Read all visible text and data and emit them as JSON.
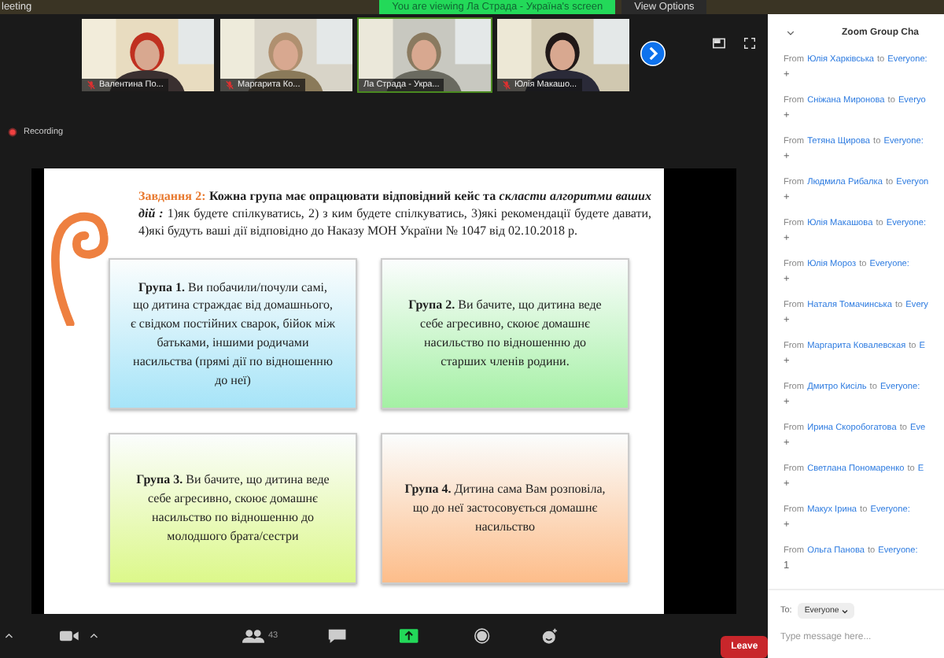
{
  "top_bar": {
    "title": "leeting",
    "banner": "You are viewing Ла Страда - Україна's screen",
    "view_options": "View Options"
  },
  "participants": [
    {
      "name": "Валентина По...",
      "muted": true,
      "speaking": false
    },
    {
      "name": "Маргарита Ко...",
      "muted": true,
      "speaking": false
    },
    {
      "name": "Ла Страда - Укра...",
      "muted": false,
      "speaking": true
    },
    {
      "name": "Юлія Макашо...",
      "muted": true,
      "speaking": false
    }
  ],
  "recording": "Recording",
  "slide": {
    "task_label": "Завдання 2:",
    "task_text": "**Кожна група має опрацювати відповідний кейс та** *скласти алгоритми ваших дій :* 1)як будете спілкуватись, 2) з ким будете спілкуватись, 3)які рекомендації будете давати, 4)які будуть ваші дії відповідно до Наказу МОН України № 1047 від 02.10.2018 р.",
    "groups": [
      {
        "text": "**Група 1.** Ви побачили/почули самі, що дитина страждає від домашнього, є свідком постійних сварок, бійок між батьками, іншими родичами насильства (прямі дії по відношенню до неї)",
        "color": "#a6e4f8"
      },
      {
        "text": "**Група 2.** Ви бачите, що дитина веде себе агресивно, скоює домашнє насильство по відношенню до старших членів родини.",
        "color": "#a4f0a4"
      },
      {
        "text": "**Група 3.** Ви бачите, що дитина веде себе агресивно, скоює домашнє насильство по відношенню до молодшого брата/сестри",
        "color": "#dcf88a"
      },
      {
        "text": "**Група 4.** Дитина сама Вам розповіла, що до неї застосовується домашнє насильство",
        "color": "#fdbd8a"
      }
    ]
  },
  "toolbar": [
    {
      "kind": "caret"
    },
    {
      "kind": "video"
    },
    {
      "kind": "caret"
    },
    {
      "kind": "participants",
      "count": "43"
    },
    {
      "kind": "chat"
    },
    {
      "kind": "share"
    },
    {
      "kind": "record"
    },
    {
      "kind": "reactions"
    }
  ],
  "leave": "Leave",
  "chat": {
    "title": "Zoom Group Cha",
    "messages": [
      {
        "from": "From",
        "sender": "Юлія Харківська",
        "to": "to",
        "recipient": "Everyone:",
        "text": "+"
      },
      {
        "from": "From",
        "sender": "Сніжана Миронова",
        "to": "to",
        "recipient": "Everyo",
        "text": "+"
      },
      {
        "from": "From",
        "sender": "Тетяна Щирова",
        "to": "to",
        "recipient": "Everyone:",
        "text": "+"
      },
      {
        "from": "From",
        "sender": "Людмила Рибалка",
        "to": "to",
        "recipient": "Everyon",
        "text": "+"
      },
      {
        "from": "From",
        "sender": "Юлія Макашова",
        "to": "to",
        "recipient": "Everyone:",
        "text": "+"
      },
      {
        "from": "From",
        "sender": "Юлія Мороз",
        "to": "to",
        "recipient": "Everyone:",
        "text": "+"
      },
      {
        "from": "From",
        "sender": "Наталя Томачинська",
        "to": "to",
        "recipient": "Every",
        "text": "+"
      },
      {
        "from": "From",
        "sender": "Маргарита Ковалевская",
        "to": "to",
        "recipient": "E",
        "text": "+"
      },
      {
        "from": "From",
        "sender": "Дмитро Кисіль",
        "to": "to",
        "recipient": "Everyone:",
        "text": "+"
      },
      {
        "from": "From",
        "sender": "Ирина Скоробогатова",
        "to": "to",
        "recipient": "Eve",
        "text": "+"
      },
      {
        "from": "From",
        "sender": "Светлана Пономаренко",
        "to": "to",
        "recipient": "E",
        "text": "+"
      },
      {
        "from": "From",
        "sender": "Макух Ірина",
        "to": "to",
        "recipient": "Everyone:",
        "text": "+"
      },
      {
        "from": "From",
        "sender": "Ольга Панова",
        "to": "to",
        "recipient": "Everyone:",
        "text": "1"
      }
    ],
    "to_label": "To:",
    "recipient_select": "Everyone",
    "placeholder": "Type message here..."
  }
}
